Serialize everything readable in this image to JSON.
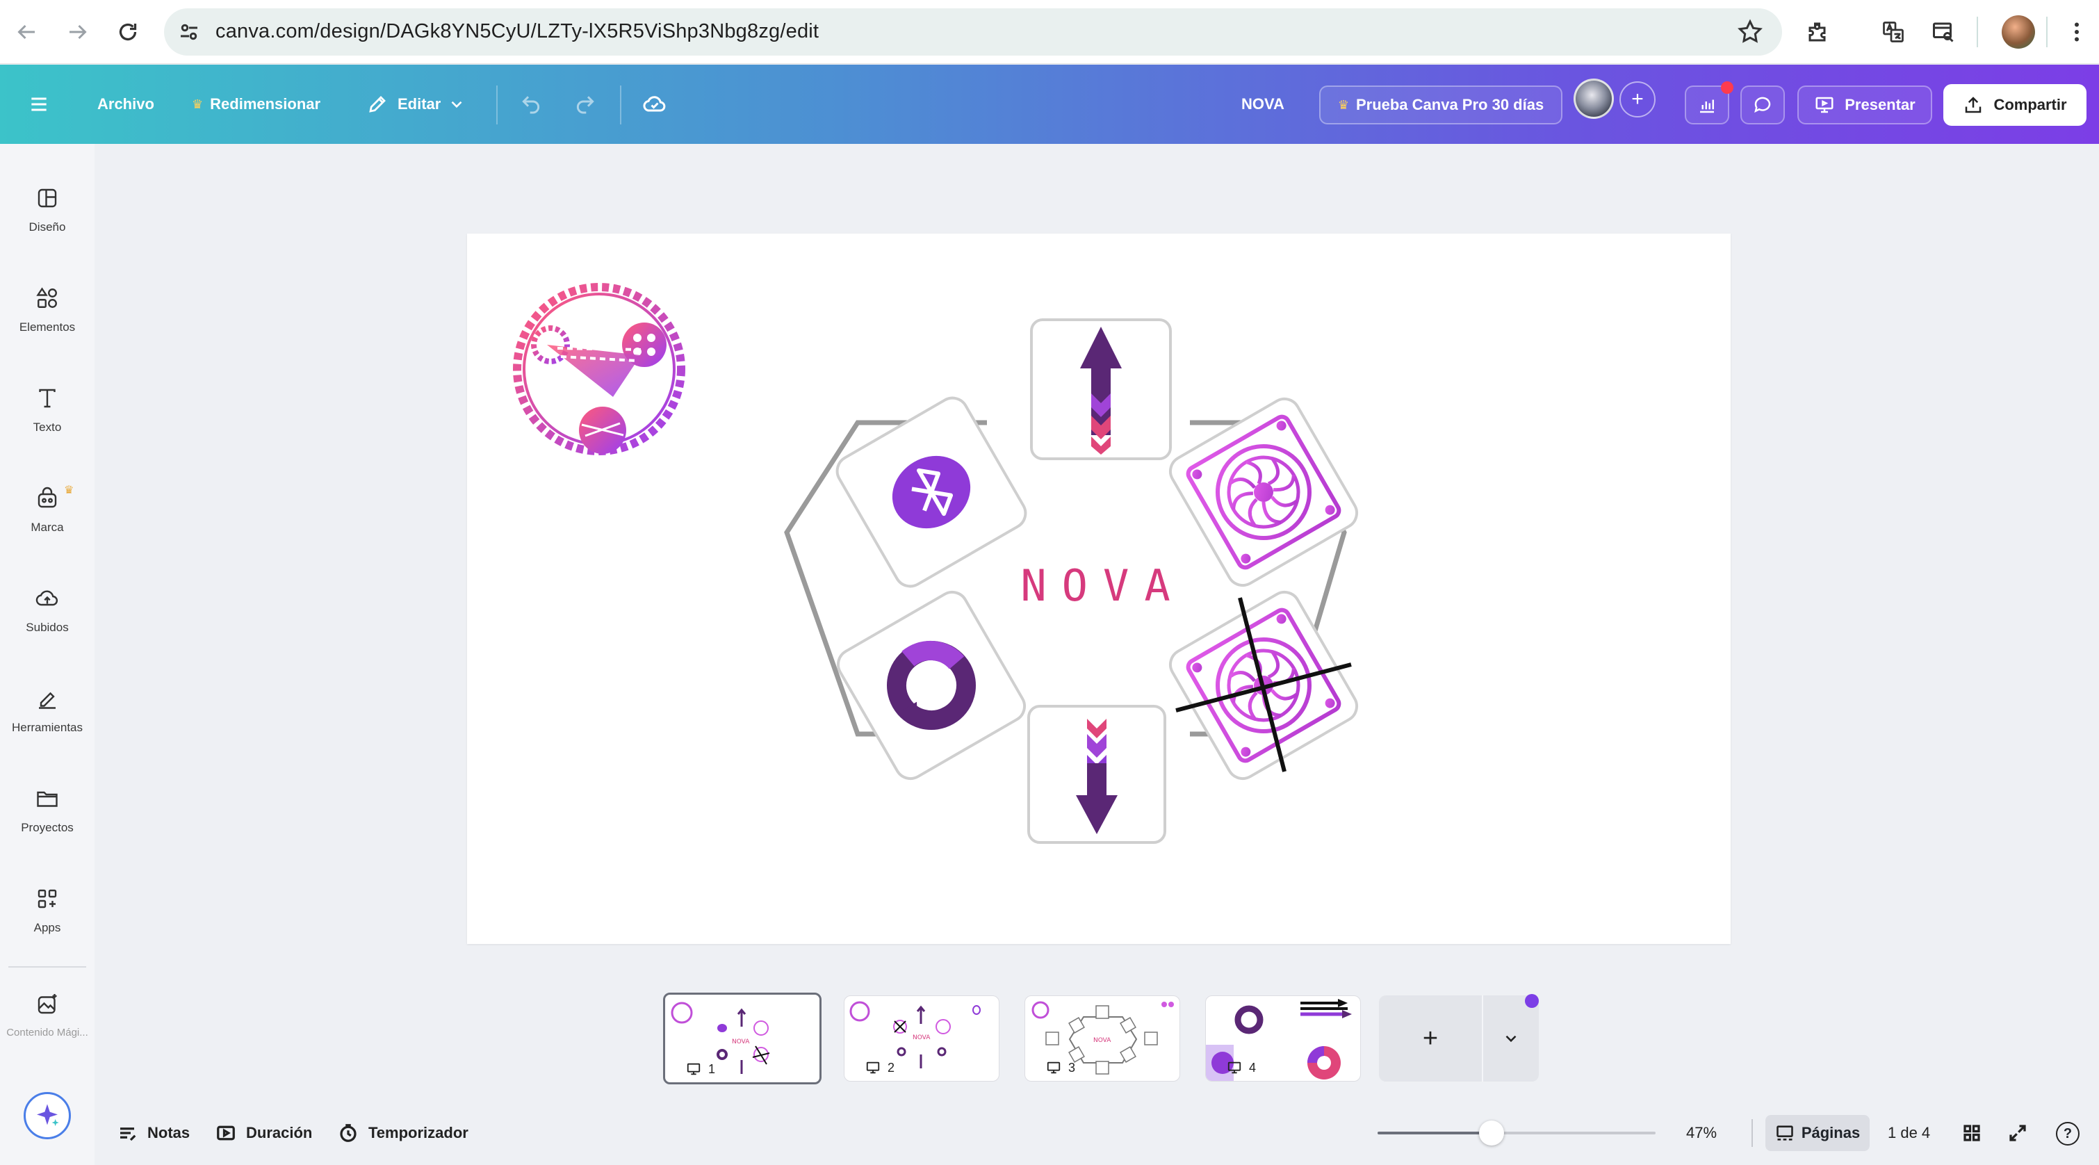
{
  "browser": {
    "url": "canva.com/design/DAGk8YN5CyU/LZTy-lX5R5ViShp3Nbg8zg/edit"
  },
  "toolbar": {
    "menu_icon": "hamburger-icon",
    "file_label": "Archivo",
    "resize_label": "Redimensionar",
    "edit_label": "Editar",
    "doc_title": "NOVA",
    "trial_label": "Prueba Canva Pro 30 días",
    "present_label": "Presentar",
    "share_label": "Compartir",
    "accent_color": "#7c3ee6"
  },
  "sidebar": {
    "items": [
      {
        "label": "Diseño",
        "icon": "layout-icon"
      },
      {
        "label": "Elementos",
        "icon": "shapes-icon"
      },
      {
        "label": "Texto",
        "icon": "text-icon"
      },
      {
        "label": "Marca",
        "icon": "brand-icon"
      },
      {
        "label": "Subidos",
        "icon": "cloud-upload-icon"
      },
      {
        "label": "Herramientas",
        "icon": "pen-icon"
      },
      {
        "label": "Proyectos",
        "icon": "folder-icon"
      },
      {
        "label": "Apps",
        "icon": "apps-icon"
      },
      {
        "label": "Contenido Mági...",
        "icon": "magic-image-icon"
      }
    ]
  },
  "canvas": {
    "wordmark": "NOVA",
    "brand_pink": "#d63a7d",
    "brand_purple": "#5a2775",
    "brand_violet": "#a044d8"
  },
  "pages": {
    "thumbs": [
      {
        "num": "1"
      },
      {
        "num": "2"
      },
      {
        "num": "3"
      },
      {
        "num": "4"
      }
    ],
    "add_label": "+"
  },
  "bottombar": {
    "notes_label": "Notas",
    "duration_label": "Duración",
    "timer_label": "Temporizador",
    "zoom_value": "47%",
    "zoom_fraction": 0.41,
    "pages_label": "Páginas",
    "page_counter": "1 de 4",
    "help_label": "?"
  }
}
